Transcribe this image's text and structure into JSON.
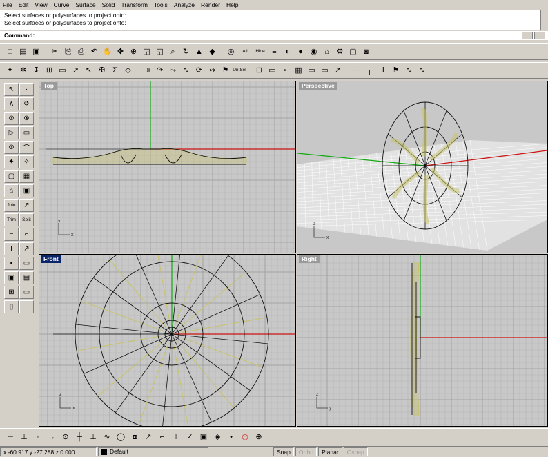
{
  "menu": [
    "File",
    "Edit",
    "View",
    "Curve",
    "Surface",
    "Solid",
    "Transform",
    "Tools",
    "Analyze",
    "Render",
    "Help"
  ],
  "command_history": [
    "Select surfaces or polysurfaces to project onto:",
    "Select surfaces or polysurfaces to project onto:"
  ],
  "command_prompt": "Command:",
  "toolbar1": [
    "□",
    "▤",
    "▣",
    "|",
    "✂",
    "⎘",
    "⎙",
    "↶",
    "✋",
    "✥",
    "⊕",
    "◲",
    "◱",
    "⌕",
    "↻",
    "▲",
    "◆",
    "|",
    "◎",
    "All",
    "Hide",
    "≡",
    "◐",
    "●",
    "◉",
    "⌂",
    "⚙",
    "▢",
    "◙"
  ],
  "toolbar2": [
    "✦",
    "✲",
    "↧",
    "⊞",
    "▭",
    "↗",
    "↖",
    "✠",
    "Σ",
    "◇",
    "|",
    "⇥",
    "↷",
    "⤳",
    "∿",
    "⟳",
    "↭",
    "⚑",
    "Un Sel",
    "|",
    "⊟",
    "▭",
    "▫",
    "▦",
    "▭",
    "▭",
    "↗",
    "|",
    "─",
    "┐",
    "‖",
    "⚑",
    "∿",
    "∿"
  ],
  "left_tools": [
    "↖",
    "·",
    "∧",
    "↺",
    "⊙",
    "⊗",
    "▷",
    "▭",
    "⊙",
    "⌒",
    "✦",
    "✧",
    "▢",
    "▦",
    "⌂",
    "▣",
    "Join",
    "↗",
    "Trim",
    "Split",
    "⌐",
    "⌐",
    "T",
    "↗",
    "▪",
    "▭",
    "▣",
    "▤",
    "⊞",
    "▭",
    "▯",
    ""
  ],
  "viewports": {
    "top": {
      "label": "Top",
      "active": false
    },
    "perspective": {
      "label": "Perspective",
      "active": false
    },
    "front": {
      "label": "Front",
      "active": true
    },
    "right": {
      "label": "Right",
      "active": false
    }
  },
  "bottom_toolbar": [
    "⊢",
    "⊥",
    "·",
    "→",
    "⊙",
    "┼",
    "⊥",
    "∿",
    "◯",
    "⧇",
    "↗",
    "⌐",
    "⊤",
    "✓",
    "▣",
    "◈",
    "•",
    "◎",
    "⊕"
  ],
  "status": {
    "coords": "x -60.917  y -27.288  z 0.000",
    "layer": "Default",
    "snap": "Snap",
    "ortho": "Ortho",
    "planar": "Planar",
    "osnap": "Osnap"
  },
  "colors": {
    "x_axis": "#cc1111",
    "y_axis": "#11aa11",
    "curve": "#111111",
    "surface": "#c8c36a",
    "grid": "#ababab",
    "viewport_bg": "#c8c8c8"
  }
}
